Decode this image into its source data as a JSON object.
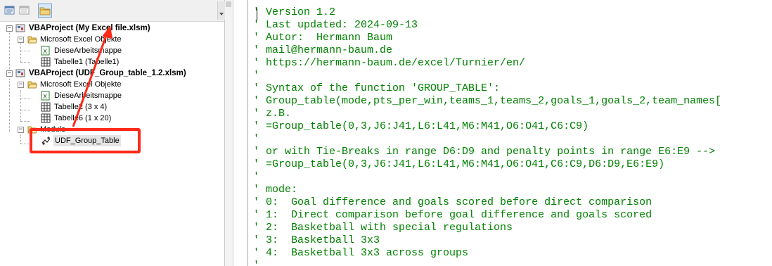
{
  "explorer": {
    "toolbar_icons": [
      "view-code-icon",
      "view-object-icon",
      "toggle-folders-icon"
    ],
    "tree": [
      {
        "label": "VBAProject (My Excel file.xlsm)"
      },
      {
        "label": "Microsoft Excel Objekte"
      },
      {
        "label": "DieseArbeitsmappe"
      },
      {
        "label": "Tabelle1 (Tabelle1)"
      },
      {
        "label": "VBAProject (UDF_Group_table_1.2.xlsm)"
      },
      {
        "label": "Microsoft Excel Objekte"
      },
      {
        "label": "DieseArbeitsmappe"
      },
      {
        "label": "Tabelle2 (3 x 4)"
      },
      {
        "label": "Tabelle6 (1 x 20)"
      },
      {
        "label": "Module"
      },
      {
        "label": "UDF_Group_Table"
      }
    ]
  },
  "code": {
    "lines": [
      "' Version 1.2",
      "' Last updated: 2024-09-13",
      "' Autor:  Hermann Baum",
      "' mail@hermann-baum.de",
      "' https://hermann-baum.de/excel/Turnier/en/",
      "'",
      "' Syntax of the function 'GROUP_TABLE':",
      "' Group_table(mode,pts_per_win,teams_1,teams_2,goals_1,goals_2,team_names[",
      "' z.B.",
      "' =Group_table(0,3,J6:J41,L6:L41,M6:M41,O6:O41,C6:C9)",
      "'",
      "' or with Tie-Breaks in range D6:D9 and penalty points in range E6:E9 -->",
      "' =Group_table(0,3,J6:J41,L6:L41,M6:M41,O6:O41,C6:C9,D6:D9,E6:E9)",
      "'",
      "' mode:",
      "' 0:  Goal difference and goals scored before direct comparison",
      "' 1:  Direct comparison before goal difference and goals scored",
      "' 2:  Basketball with special regulations",
      "' 3:  Basketball 3x3",
      "' 4:  Basketball 3x3 across groups",
      "'"
    ]
  },
  "colors": {
    "comment": "#008000",
    "annotation": "#ff2a1a"
  }
}
